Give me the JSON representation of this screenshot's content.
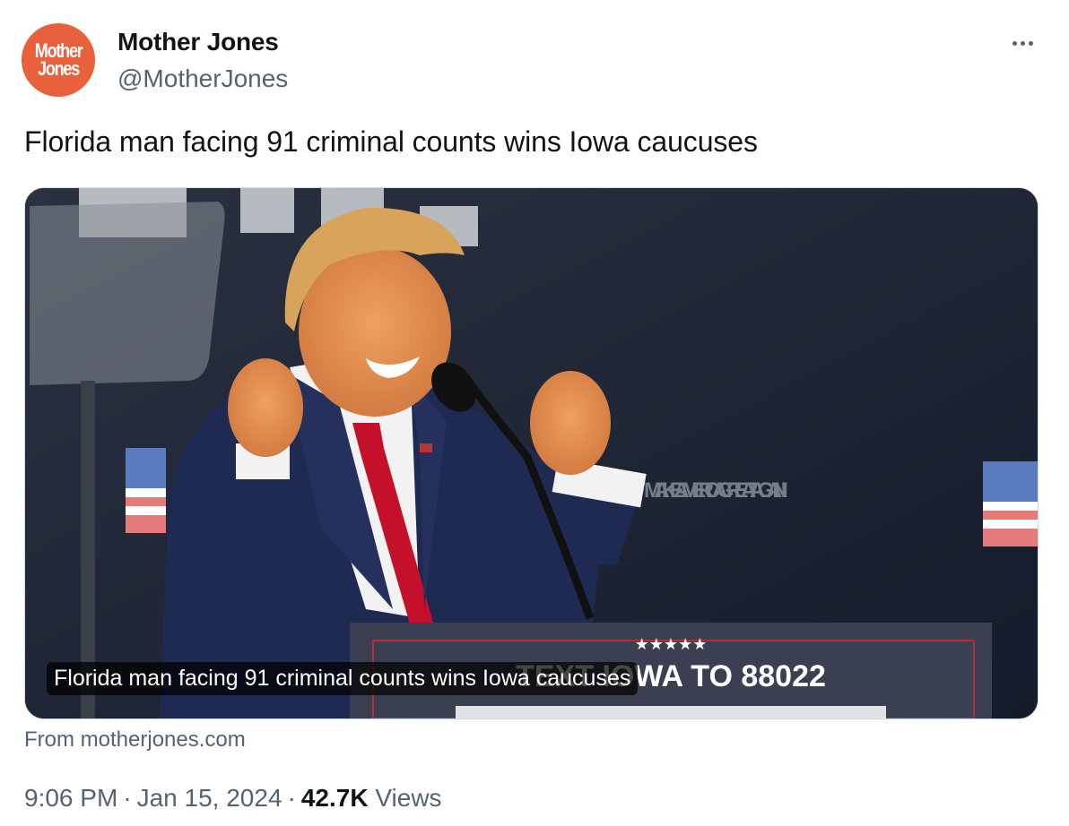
{
  "author": {
    "avatar_line1": "Mother",
    "avatar_line2": "Jones",
    "display_name": "Mother Jones",
    "handle": "@MotherJones"
  },
  "tweet": {
    "text": "Florida man facing 91 criminal counts wins Iowa caucuses"
  },
  "card": {
    "caption": "Florida man facing 91 criminal counts wins Iowa caucuses",
    "source": "From motherjones.com",
    "image_subject": "man-cheering-at-rally-podium",
    "podium_text": "TEXT IOWA TO 88022",
    "podium_stars": "★★★★★",
    "backdrop_text": "MAKE AMERICA GREAT AGAIN!"
  },
  "meta": {
    "time": "9:06 PM",
    "date": "Jan 15, 2024",
    "views_count": "42.7K",
    "views_label": "Views"
  },
  "colors": {
    "brand_orange": "#e8603c",
    "text_primary": "#0f1419",
    "text_secondary": "#536471",
    "border": "#cfd9de"
  },
  "icons": {
    "more": "more-options-icon"
  }
}
